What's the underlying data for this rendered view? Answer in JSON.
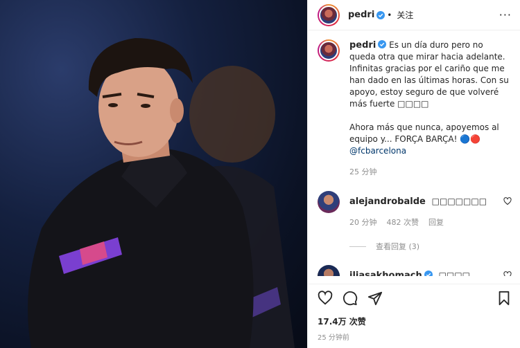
{
  "post": {
    "author": "pedri",
    "follow_label": "关注",
    "more_label": "···"
  },
  "caption": {
    "author": "pedri",
    "text": "Es un día duro pero no queda otra que mirar hacia adelante. Infinitas gracias por el cariño que me han dado en las últimas horas. Con su apoyo, estoy seguro de que volveré más fuerte □□□□\n\nAhora más que nunca, apoyemos al equipo y... FORÇA BARÇA! 🔵🔴",
    "mention": "@fcbarcelona",
    "time": "25 分钟"
  },
  "comments": [
    {
      "author": "alejandrobalde",
      "text": "□□□□□□□",
      "time": "20 分钟",
      "likes": "482 次赞",
      "reply_label": "回复",
      "view_replies": "查看回复 (3)"
    },
    {
      "author": "iliasakhomach",
      "text": "□□□□"
    }
  ],
  "stats": {
    "views": "17.4万 次赞",
    "time_ago": "25 分钟前"
  },
  "icons": [
    "heart-icon",
    "comment-icon",
    "share-icon",
    "bookmark-icon",
    "verified-badge-icon"
  ],
  "colors": {
    "verified": "#3897f0",
    "mention": "#00376b",
    "muted": "#8e8e8e"
  }
}
